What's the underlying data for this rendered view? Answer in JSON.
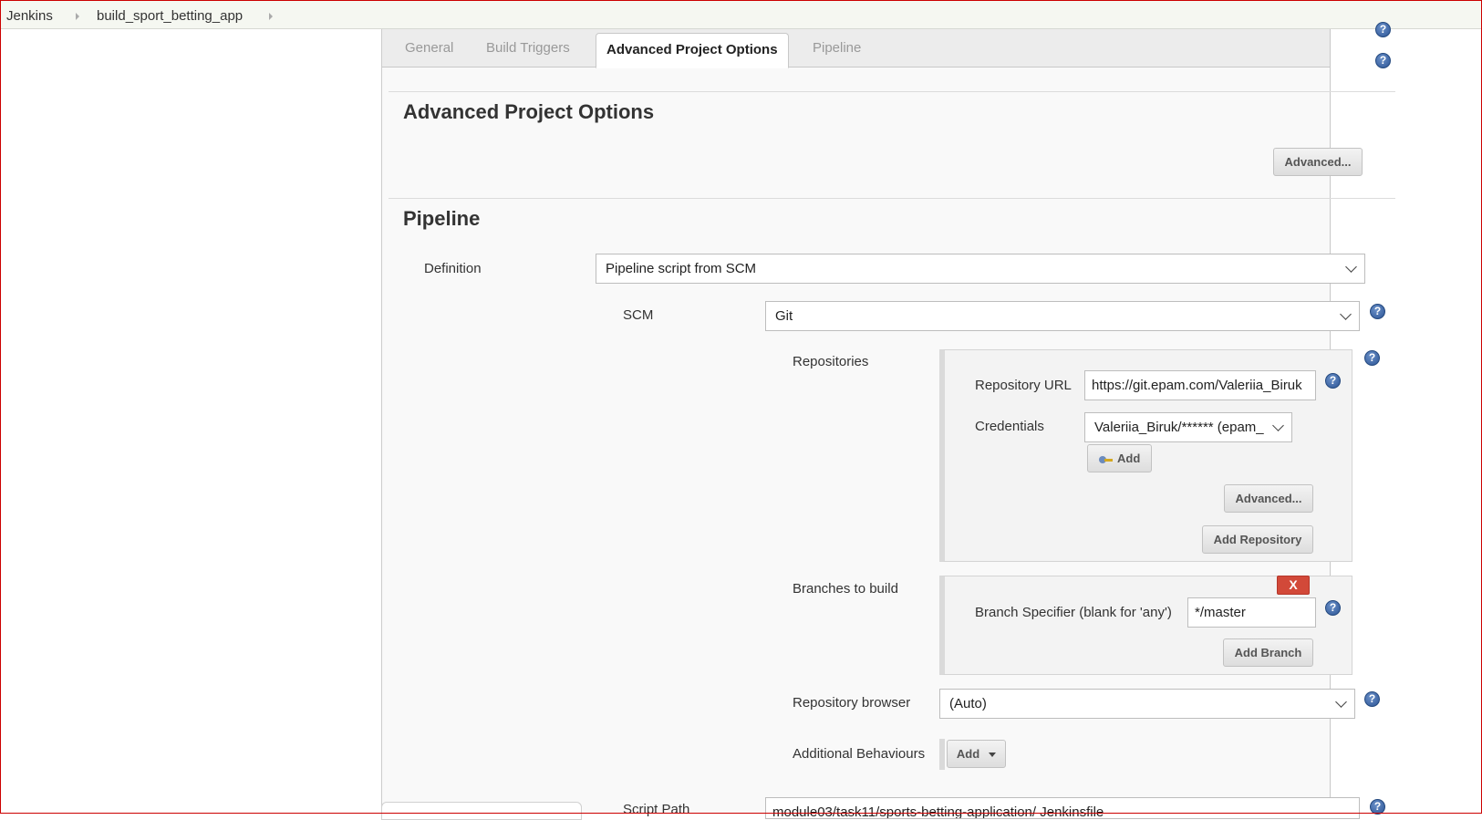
{
  "breadcrumb": {
    "items": [
      "Jenkins",
      "build_sport_betting_app"
    ]
  },
  "tabs": [
    {
      "label": "General",
      "active": false
    },
    {
      "label": "Build Triggers",
      "active": false
    },
    {
      "label": "Advanced Project Options",
      "active": true
    },
    {
      "label": "Pipeline",
      "active": false
    }
  ],
  "advanced_section": {
    "title": "Advanced Project Options",
    "advanced_button": "Advanced..."
  },
  "pipeline_section": {
    "title": "Pipeline",
    "definition_label": "Definition",
    "definition_value": "Pipeline script from SCM",
    "scm_label": "SCM",
    "scm_value": "Git",
    "repositories_label": "Repositories",
    "repository_url_label": "Repository URL",
    "repository_url_value": "https://git.epam.com/Valeriia_Biruk",
    "credentials_label": "Credentials",
    "credentials_value": "Valeriia_Biruk/****** (epam_",
    "add_label": "Add",
    "repo_advanced_button": "Advanced...",
    "add_repository_button": "Add Repository",
    "branches_label": "Branches to build",
    "delete_branch_button": "X",
    "branch_specifier_label": "Branch Specifier (blank for 'any')",
    "branch_specifier_value": "*/master",
    "add_branch_button": "Add Branch",
    "repository_browser_label": "Repository browser",
    "repository_browser_value": "(Auto)",
    "additional_behaviours_label": "Additional Behaviours",
    "additional_add_button": "Add",
    "script_path_label": "Script Path",
    "script_path_value": "module03/task11/sports-betting-application/ Jenkinsfile"
  },
  "help_icon_glyph": "?"
}
